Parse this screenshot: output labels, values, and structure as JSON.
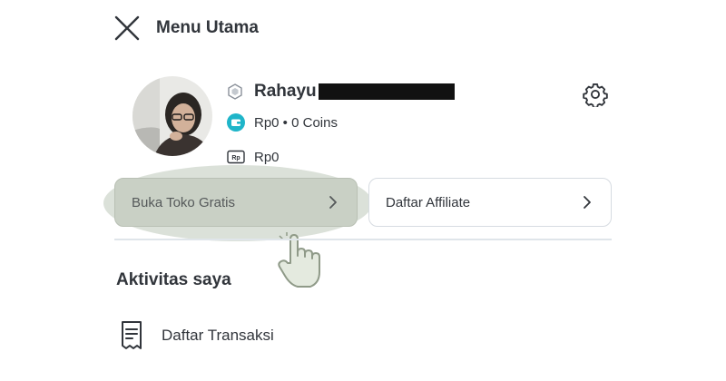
{
  "header": {
    "title": "Menu Utama",
    "close_icon": "close-icon"
  },
  "profile": {
    "name": "Rahayu",
    "name_redacted": true,
    "balance_text": "Rp0 • 0 Coins",
    "rp_text": "Rp0",
    "badge_icon": "badge-icon",
    "wallet_icon": "wallet-icon",
    "rp_icon": "rupiah-card-icon",
    "settings_icon": "gear-icon"
  },
  "actions": {
    "open_shop_label": "Buka Toko Gratis",
    "affiliate_label": "Daftar Affiliate"
  },
  "section": {
    "title": "Aktivitas saya"
  },
  "menu": {
    "items": [
      {
        "label": "Daftar Transaksi",
        "icon": "receipt-icon"
      }
    ]
  },
  "colors": {
    "text": "#31353b",
    "accent": "#03ac0e",
    "wallet_teal": "#1fb5c9",
    "highlight": "#c9d0c5"
  }
}
